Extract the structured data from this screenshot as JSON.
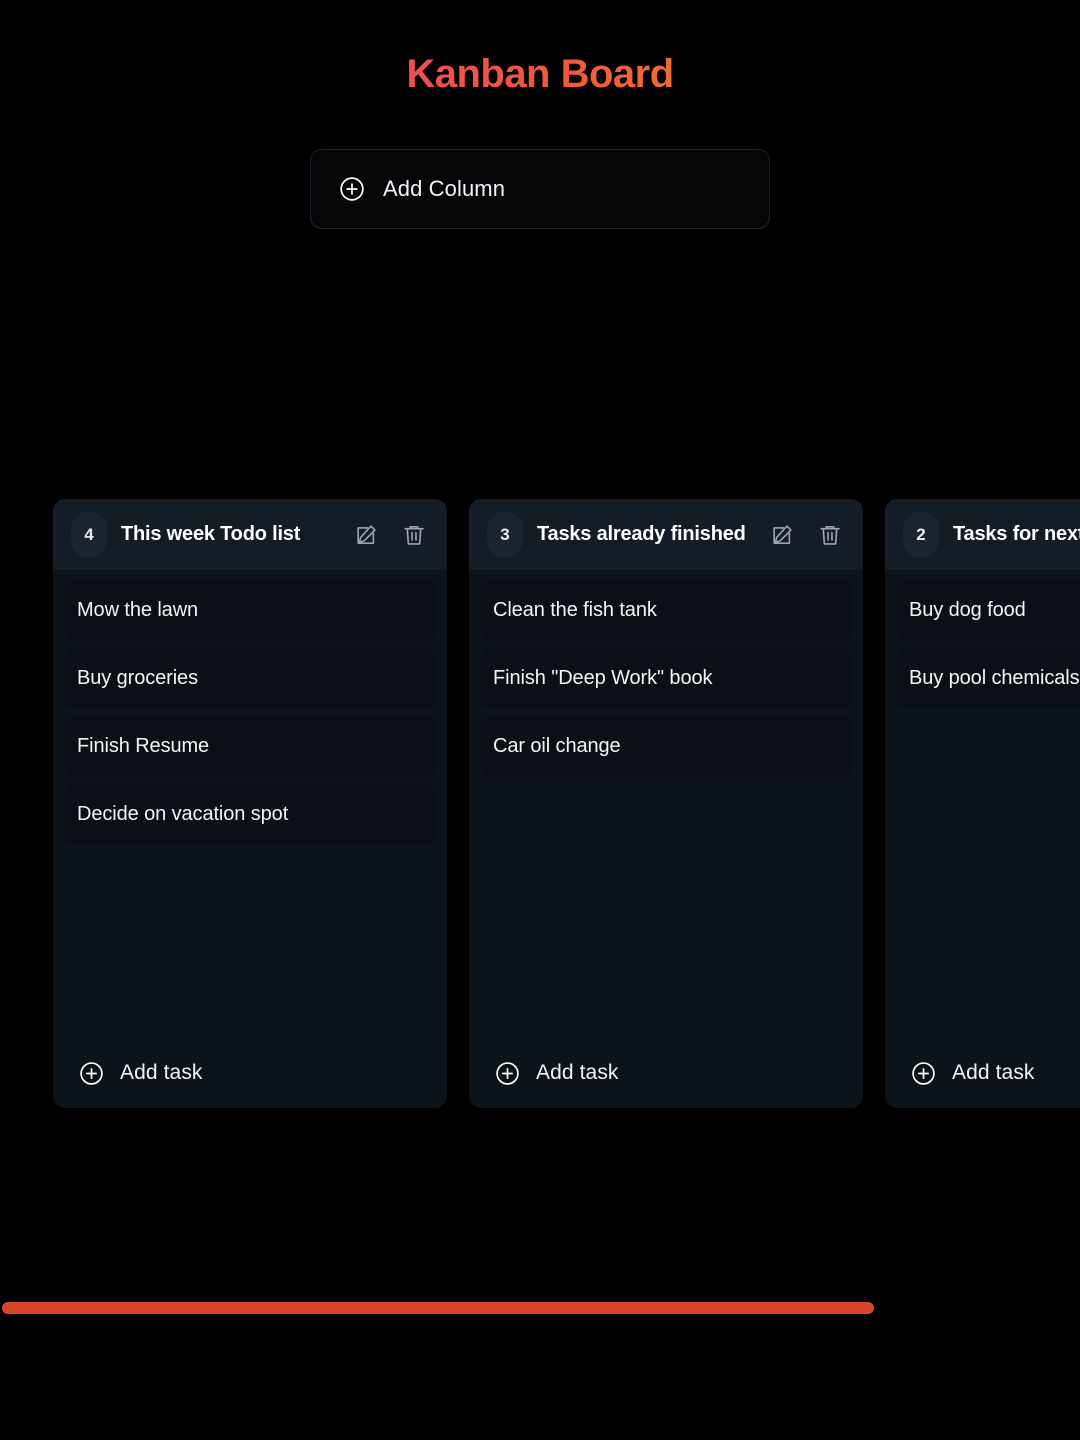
{
  "header": {
    "title": "Kanban Board",
    "title_gradient_from": "#f0308c",
    "title_gradient_mid": "#ef5a3a",
    "title_gradient_to": "#f5a71a"
  },
  "add_column": {
    "label": "Add Column",
    "icon": "plus-circle-icon"
  },
  "icons": {
    "edit": "edit-pencil-icon",
    "delete": "trash-icon",
    "add": "plus-circle-icon"
  },
  "columns": [
    {
      "count": "4",
      "title": "This week Todo list",
      "add_task_label": "Add task",
      "tasks": [
        {
          "title": "Mow the lawn"
        },
        {
          "title": "Buy groceries"
        },
        {
          "title": "Finish Resume"
        },
        {
          "title": "Decide on vacation spot"
        }
      ]
    },
    {
      "count": "3",
      "title": "Tasks already finished",
      "add_task_label": "Add task",
      "tasks": [
        {
          "title": "Clean the fish tank"
        },
        {
          "title": "Finish \"Deep Work\" book"
        },
        {
          "title": "Car oil change"
        }
      ]
    },
    {
      "count": "2",
      "title": "Tasks for next week",
      "add_task_label": "Add task",
      "tasks": [
        {
          "title": "Buy dog food"
        },
        {
          "title": "Buy pool chemicals"
        }
      ]
    }
  ],
  "scrollbar": {
    "orientation": "horizontal",
    "thumb_color": "#d9472b"
  }
}
